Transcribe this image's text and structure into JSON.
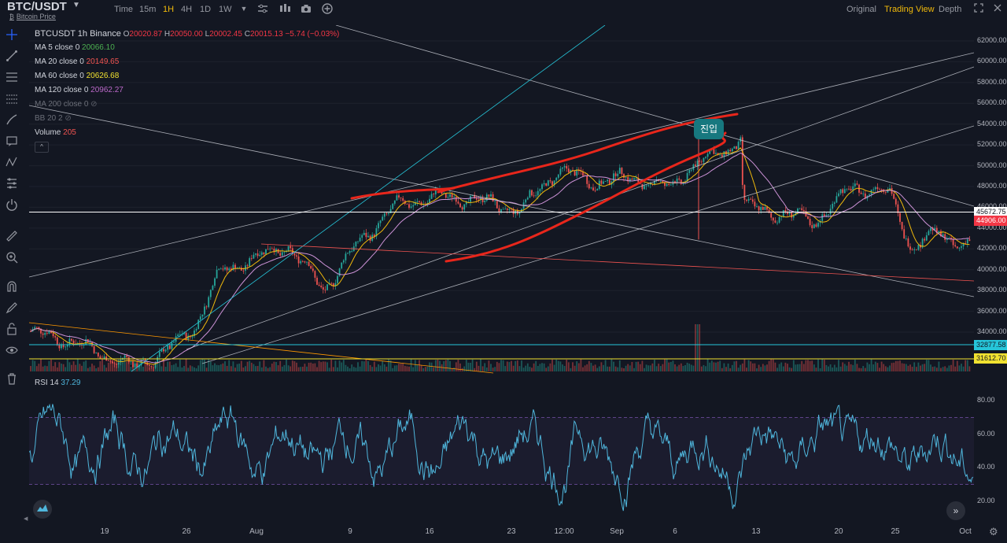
{
  "header": {
    "symbol": "BTC/USDT",
    "subtitle": "Bitcoin Price",
    "timeframes": [
      "Time",
      "15m",
      "1H",
      "4H",
      "1D",
      "1W"
    ],
    "active_timeframe": "1H",
    "views": [
      "Original",
      "Trading View",
      "Depth"
    ],
    "active_view": "Trading View"
  },
  "icons": {
    "toolbar": [
      "chevron-down-icon",
      "indicators-icon",
      "candle-type-icon",
      "camera-icon",
      "add-icon"
    ],
    "left": [
      "crosshair-icon",
      "trendline-icon",
      "fib-icon",
      "brush-icon",
      "text-icon",
      "pattern-icon",
      "measure-icon",
      "magnet-icon",
      "ruler-icon",
      "zoom-icon",
      "lock-magnet-icon",
      "edit-lock-icon",
      "lock-icon",
      "eye-icon",
      "trash-icon"
    ]
  },
  "legend": {
    "pair_line": "BTCUSDT  1h  Binance",
    "o_key": "O",
    "o_val": "20020.87",
    "h_key": "H",
    "h_val": "20050.00",
    "l_key": "L",
    "l_val": "20002.45",
    "c_key": "C",
    "c_val": "20015.13",
    "change": "−5.74  (−0.03%)",
    "ma5_label": "MA 5 close 0",
    "ma5_val": "20066.10",
    "ma20_label": "MA 20 close 0",
    "ma20_val": "20149.65",
    "ma60_label": "MA 60 close 0",
    "ma60_val": "20626.68",
    "ma120_label": "MA 120 close 0",
    "ma120_val": "20962.27",
    "ma200_label": "MA 200 close 0",
    "bb_label": "BB 20 2",
    "vol_label": "Volume",
    "vol_val": "205",
    "rsi_label": "RSI 14",
    "rsi_val": "37.29"
  },
  "annotation": {
    "text": "진입"
  },
  "colors": {
    "bg": "#131722",
    "up": "#26a69a",
    "down": "#ef5350",
    "ma5": "#4caf50",
    "ma20": "#f0b90b",
    "ma60": "#ce93d8",
    "ma120": "#9c27b0",
    "accent": "#f0b90b",
    "rsi": "#4fb6dc",
    "marker": "#e8261b"
  },
  "price_tags": [
    {
      "text": "45672.75",
      "bg": "#ffffff",
      "fg": "#131722"
    },
    {
      "text": "44906.00",
      "bg": "#f23645",
      "fg": "#ffffff"
    },
    {
      "text": "32877.58",
      "bg": "#26c6da",
      "fg": "#131722"
    },
    {
      "text": "31612.70",
      "bg": "#f0e130",
      "fg": "#131722"
    }
  ],
  "chart_data": [
    {
      "type": "candlestick",
      "ylim": [
        30000,
        63000
      ],
      "y_ticks": [
        "62000.00",
        "60000.00",
        "58000.00",
        "56000.00",
        "54000.00",
        "52000.00",
        "50000.00",
        "48000.00",
        "46000.00",
        "44000.00",
        "42000.00",
        "40000.00",
        "38000.00",
        "36000.00",
        "34000.00"
      ],
      "x_ticks": [
        "19",
        "26",
        "Aug",
        "9",
        "16",
        "23",
        "12:00",
        "Sep",
        "6",
        "13",
        "20",
        "25",
        "Oct"
      ],
      "approx_close_path": [
        {
          "x": "Jul 13",
          "y": 33800
        },
        {
          "x": "Jul 16",
          "y": 32600
        },
        {
          "x": "Jul 20",
          "y": 30600
        },
        {
          "x": "Jul 23",
          "y": 32400
        },
        {
          "x": "Jul 25",
          "y": 34600
        },
        {
          "x": "Jul 27",
          "y": 39800
        },
        {
          "x": "Jul 30",
          "y": 41200
        },
        {
          "x": "Aug 1",
          "y": 42300
        },
        {
          "x": "Aug 4",
          "y": 38100
        },
        {
          "x": "Aug 7",
          "y": 42900
        },
        {
          "x": "Aug 10",
          "y": 46300
        },
        {
          "x": "Aug 13",
          "y": 47000
        },
        {
          "x": "Aug 16",
          "y": 46800
        },
        {
          "x": "Aug 20",
          "y": 45700
        },
        {
          "x": "Aug 23",
          "y": 49600
        },
        {
          "x": "Aug 26",
          "y": 48400
        },
        {
          "x": "Aug 29",
          "y": 48900
        },
        {
          "x": "Sep 1",
          "y": 47800
        },
        {
          "x": "Sep 3",
          "y": 50000
        },
        {
          "x": "Sep 6",
          "y": 51700
        },
        {
          "x": "Sep 7",
          "y": 52700
        },
        {
          "x": "Sep 7 12:00",
          "y": 46100
        },
        {
          "x": "Sep 10",
          "y": 45400
        },
        {
          "x": "Sep 13",
          "y": 44700
        },
        {
          "x": "Sep 16",
          "y": 48000
        },
        {
          "x": "Sep 19",
          "y": 47400
        },
        {
          "x": "Sep 21",
          "y": 42100
        },
        {
          "x": "Sep 23",
          "y": 43600
        },
        {
          "x": "Sep 25",
          "y": 42400
        },
        {
          "x": "Sep 28",
          "y": 41900
        },
        {
          "x": "Oct 1",
          "y": 43600
        }
      ]
    },
    {
      "type": "line",
      "title": "RSI 14",
      "ylim": [
        10,
        90
      ],
      "y_ticks": [
        "80.00",
        "60.00",
        "40.00",
        "20.00"
      ],
      "bands": [
        70,
        30
      ]
    }
  ]
}
